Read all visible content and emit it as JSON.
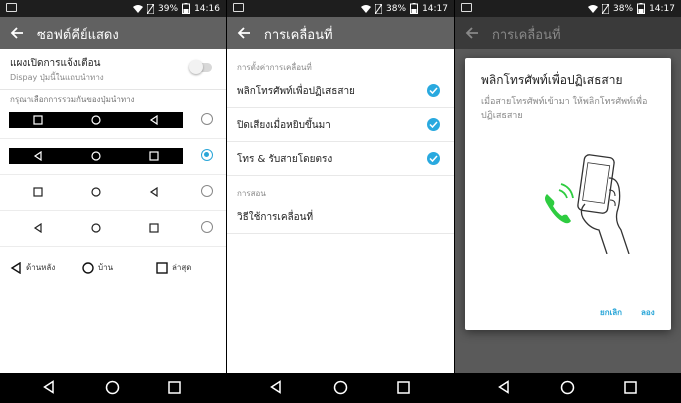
{
  "screen1": {
    "status": {
      "battery": "39%",
      "time": "14:16"
    },
    "title": "ซอฟต์คีย์แสดง",
    "notification_panel": {
      "label": "แผงเปิดการแจ้งเตือน",
      "sub": "Dispay ปุ่มนี้ในแถบนำทาง",
      "enabled": false
    },
    "hint": "กรุณาเลือกการรวมกันของปุ่มนำทาง",
    "layouts": [
      {
        "icons": [
          "recent-icon",
          "home-icon",
          "back-icon"
        ],
        "dark": true,
        "selected": false
      },
      {
        "icons": [
          "back-icon",
          "home-icon",
          "recent-icon"
        ],
        "dark": true,
        "selected": true
      },
      {
        "icons": [
          "recent-icon",
          "home-icon",
          "back-icon"
        ],
        "dark": false,
        "selected": false
      },
      {
        "icons": [
          "back-icon",
          "home-icon",
          "recent-icon"
        ],
        "dark": false,
        "selected": false
      }
    ],
    "legend": {
      "back": "ด้านหลัง",
      "home": "บ้าน",
      "recent": "ล่าสุด"
    }
  },
  "screen2": {
    "status": {
      "battery": "38%",
      "time": "14:17"
    },
    "title": "การเคลื่อนที่",
    "section1": "การตั้งค่าการเคลื่อนที่",
    "items": [
      {
        "label": "พลิกโทรศัพท์เพื่อปฏิเสธสาย",
        "checked": true
      },
      {
        "label": "ปิดเสียงเมื่อหยิบขึ้นมา",
        "checked": true
      },
      {
        "label": "โทร & รับสายโดยตรง",
        "checked": true
      }
    ],
    "section2": "การสอน",
    "tutorial": "วิธีใช้การเคลื่อนที่"
  },
  "screen3": {
    "status": {
      "battery": "38%",
      "time": "14:17"
    },
    "title": "การเคลื่อนที่",
    "dialog": {
      "title": "พลิกโทรศัพท์เพื่อปฏิเสธสาย",
      "body": "เมื่อสายโทรศัพท์เข้ามา ให้พลิกโทรศัพท์เพื่อปฏิเสธสาย",
      "cancel": "ยกเลิก",
      "try": "ลอง"
    }
  },
  "colors": {
    "appbar": "#616161",
    "accent": "#29a9df",
    "statusbar": "#1e1e1e",
    "navbar": "#000000"
  }
}
